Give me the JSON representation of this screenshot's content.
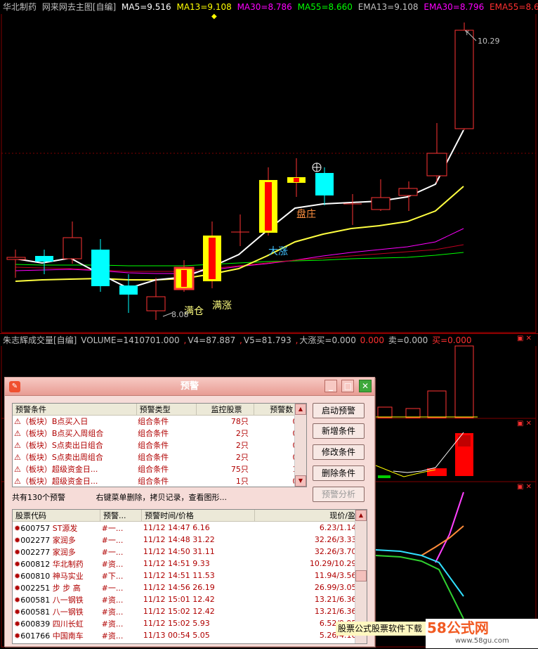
{
  "main_header": {
    "stock_name": "华北制药",
    "formula": "网来网去主图[自编]",
    "ma5": "MA5=9.516",
    "ma13": "MA13=9.108",
    "ma30": "MA30=8.786",
    "ma55": "MA55=8.660",
    "ema13": "EMA13=9.108",
    "ema30": "EMA30=8.796",
    "ema55": "EMA55=8.6"
  },
  "chart_labels": {
    "high_price": "10.29",
    "low_price": "8.08",
    "manchang": "满仓",
    "manzhang": "满涨",
    "dazhang": "大涨",
    "panzhuang": "盘庄"
  },
  "volume_header": {
    "formula": "朱志辉成交量[自编]",
    "volume": "VOLUME=1410701.000",
    "v4": "V4=87.887",
    "v5": "V5=81.793",
    "dazhang_buy": "大涨买=0.000",
    "zero": "0.000",
    "sell": "卖=0.000",
    "buy": "买=0.000"
  },
  "dialog": {
    "title": "预警",
    "conditions_headers": [
      "预警条件",
      "预警类型",
      "监控股票",
      "预警数"
    ],
    "conditions": [
      {
        "name": "（板块）B点买入日",
        "type": "组合条件",
        "stocks": "78只",
        "count": "0"
      },
      {
        "name": "（板块）B点买入周组合",
        "type": "组合条件",
        "stocks": "2只",
        "count": "0"
      },
      {
        "name": "（板块）S点卖出日组合",
        "type": "组合条件",
        "stocks": "2只",
        "count": "0"
      },
      {
        "name": "（板块）S点卖出周组合",
        "type": "组合条件",
        "stocks": "2只",
        "count": "0"
      },
      {
        "name": "（板块）超级资金日...",
        "type": "组合条件",
        "stocks": "75只",
        "count": "1"
      },
      {
        "name": "（板块）超级资金日...",
        "type": "组合条件",
        "stocks": "1只",
        "count": "0"
      }
    ],
    "buttons": {
      "start": "启动预警",
      "add": "新增条件",
      "modify": "修改条件",
      "delete": "删除条件",
      "analyze": "预警分析"
    },
    "status_count": "共有130个预警",
    "status_hint": "右键菜单删除，拷贝记录，查看图形...",
    "records_headers": [
      "股票代码",
      "预警...",
      "预警时间/价格",
      "现价/盈亏"
    ],
    "records": [
      {
        "code": "600757",
        "name": "ST源发",
        "cond": "#一...",
        "time": "11/12 14:47",
        "price": "6.16",
        "now": "6.23/1.14%"
      },
      {
        "code": "002277",
        "name": "家润多",
        "cond": "#一...",
        "time": "11/12 14:48",
        "price": "31.22",
        "now": "32.26/3.33%"
      },
      {
        "code": "002277",
        "name": "家润多",
        "cond": "#一...",
        "time": "11/12 14:50",
        "price": "31.11",
        "now": "32.26/3.70%"
      },
      {
        "code": "600812",
        "name": "华北制药",
        "cond": "#资...",
        "time": "11/12 14:51",
        "price": "9.33",
        "now": "10.29/10.29%"
      },
      {
        "code": "600810",
        "name": "神马实业",
        "cond": "#下...",
        "time": "11/12 14:51",
        "price": "11.53",
        "now": "11.94/3.56%"
      },
      {
        "code": "002251",
        "name": "步 步 高",
        "cond": "#一...",
        "time": "11/12 14:56",
        "price": "26.19",
        "now": "26.99/3.05%"
      },
      {
        "code": "600581",
        "name": "八一钢铁",
        "cond": "#资...",
        "time": "11/12 15:01",
        "price": "12.42",
        "now": "13.21/6.36%"
      },
      {
        "code": "600581",
        "name": "八一钢铁",
        "cond": "#资...",
        "time": "11/12 15:02",
        "price": "12.42",
        "now": "13.21/6.36%"
      },
      {
        "code": "600839",
        "name": "四川长虹",
        "cond": "#资...",
        "time": "11/12 15:02",
        "price": "5.93",
        "now": "6.52/9.95%"
      },
      {
        "code": "601766",
        "name": "中国南车",
        "cond": "#资...",
        "time": "11/13 00:54",
        "price": "5.05",
        "now": "5.26/4.16%"
      }
    ]
  },
  "ad_text": "股票公式股票软件下载",
  "watermark": {
    "brand": "58公式网",
    "url": "www.58gu.com"
  },
  "colors": {
    "up": "#ff3333",
    "down": "#00ffff",
    "ma5": "#ffffff",
    "ma13": "#ffff00",
    "ma30": "#ff00ff",
    "ma55": "#00ff00"
  }
}
